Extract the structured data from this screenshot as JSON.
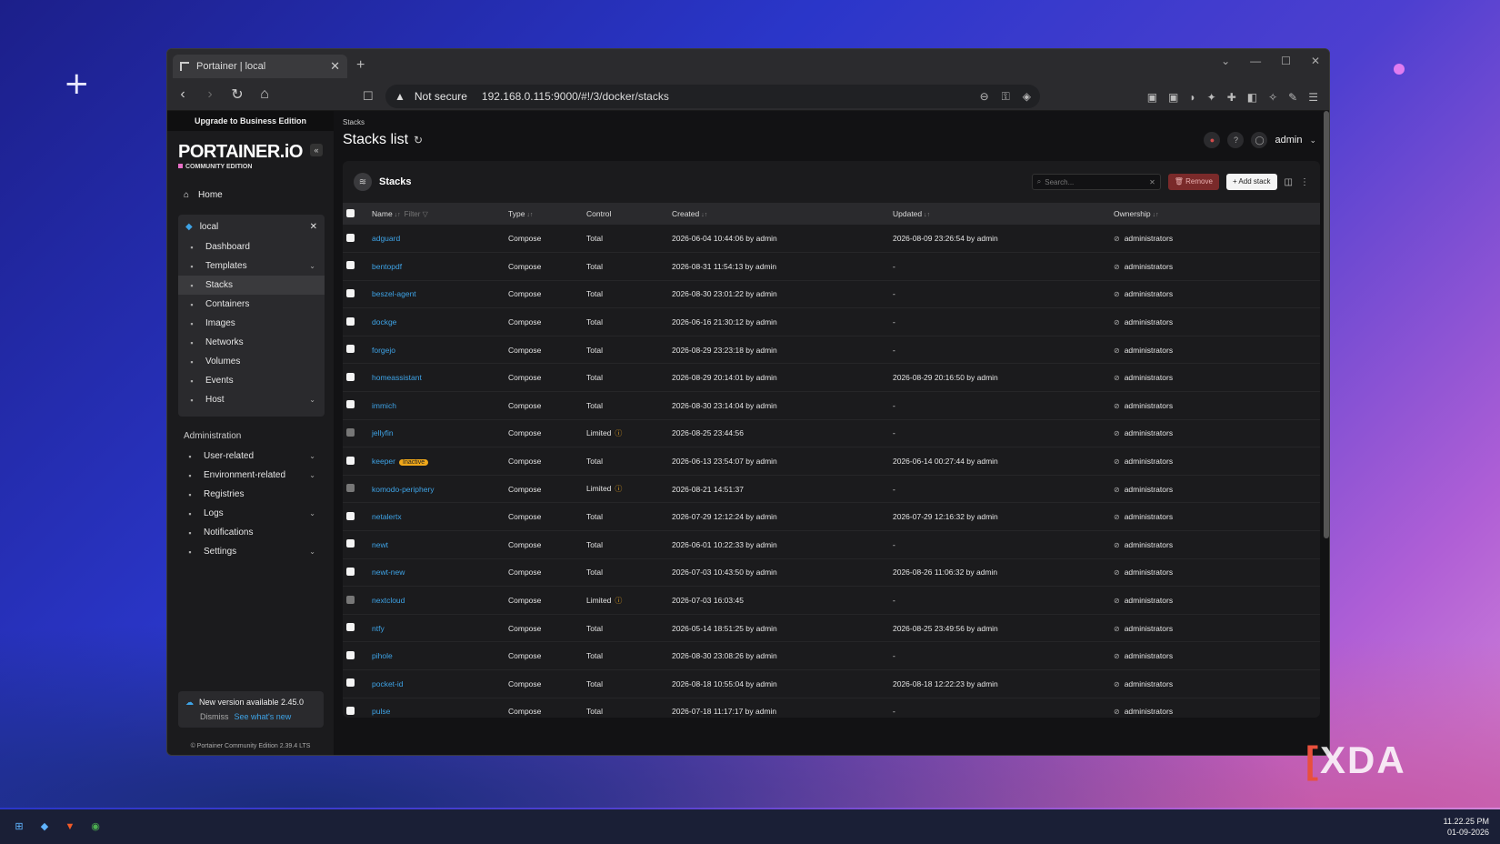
{
  "browser": {
    "tab_title": "Portainer | local",
    "security_label": "Not secure",
    "url": "192.168.0.115:9000/#!/3/docker/stacks"
  },
  "sidebar": {
    "upgrade_label": "Upgrade to Business Edition",
    "logo_main": "PORTAINER.iO",
    "logo_sub": "COMMUNITY EDITION",
    "home_label": "Home",
    "env_name": "local",
    "env_items": [
      {
        "label": "Dashboard",
        "icon": "dashboard-icon"
      },
      {
        "label": "Templates",
        "icon": "templates-icon",
        "chevron": true
      },
      {
        "label": "Stacks",
        "icon": "stacks-icon",
        "active": true
      },
      {
        "label": "Containers",
        "icon": "containers-icon"
      },
      {
        "label": "Images",
        "icon": "images-icon"
      },
      {
        "label": "Networks",
        "icon": "networks-icon"
      },
      {
        "label": "Volumes",
        "icon": "volumes-icon"
      },
      {
        "label": "Events",
        "icon": "events-icon"
      },
      {
        "label": "Host",
        "icon": "host-icon",
        "chevron": true
      }
    ],
    "admin_title": "Administration",
    "admin_items": [
      {
        "label": "User-related",
        "icon": "users-icon",
        "chevron": true
      },
      {
        "label": "Environment-related",
        "icon": "environment-icon",
        "chevron": true
      },
      {
        "label": "Registries",
        "icon": "registries-icon"
      },
      {
        "label": "Logs",
        "icon": "logs-icon",
        "chevron": true
      },
      {
        "label": "Notifications",
        "icon": "bell-icon"
      },
      {
        "label": "Settings",
        "icon": "gear-icon",
        "chevron": true
      }
    ],
    "new_version": "New version available 2.45.0",
    "dismiss": "Dismiss",
    "whats_new": "See what's new",
    "footer": "© Portainer Community Edition 2.39.4 LTS"
  },
  "main": {
    "breadcrumb": "Stacks",
    "page_title": "Stacks list",
    "user": "admin",
    "panel_title": "Stacks",
    "search_placeholder": "Search...",
    "remove_label": "Remove",
    "add_label": "+ Add stack",
    "columns": {
      "name": "Name",
      "filter": "Filter",
      "type": "Type",
      "control": "Control",
      "created": "Created",
      "updated": "Updated",
      "ownership": "Ownership"
    },
    "rows": [
      {
        "name": "adguard",
        "type": "Compose",
        "control": "Total",
        "created": "2026-06-04 10:44:06 by admin",
        "updated": "2026-08-09 23:26:54 by admin",
        "ownership": "administrators"
      },
      {
        "name": "bentopdf",
        "type": "Compose",
        "control": "Total",
        "created": "2026-08-31 11:54:13 by admin",
        "updated": "-",
        "ownership": "administrators"
      },
      {
        "name": "beszel-agent",
        "type": "Compose",
        "control": "Total",
        "created": "2026-08-30 23:01:22 by admin",
        "updated": "-",
        "ownership": "administrators"
      },
      {
        "name": "dockge",
        "type": "Compose",
        "control": "Total",
        "created": "2026-06-16 21:30:12 by admin",
        "updated": "-",
        "ownership": "administrators"
      },
      {
        "name": "forgejo",
        "type": "Compose",
        "control": "Total",
        "created": "2026-08-29 23:23:18 by admin",
        "updated": "-",
        "ownership": "administrators"
      },
      {
        "name": "homeassistant",
        "type": "Compose",
        "control": "Total",
        "created": "2026-08-29 20:14:01 by admin",
        "updated": "2026-08-29 20:16:50 by admin",
        "ownership": "administrators"
      },
      {
        "name": "immich",
        "type": "Compose",
        "control": "Total",
        "created": "2026-08-30 23:14:04 by admin",
        "updated": "-",
        "ownership": "administrators"
      },
      {
        "name": "jellyfin",
        "type": "Compose",
        "control": "Limited",
        "created": "2026-08-25 23:44:56",
        "updated": "-",
        "ownership": "administrators",
        "disabled": true
      },
      {
        "name": "keeper",
        "badge": "Inactive",
        "type": "Compose",
        "control": "Total",
        "created": "2026-06-13 23:54:07 by admin",
        "updated": "2026-06-14 00:27:44 by admin",
        "ownership": "administrators"
      },
      {
        "name": "komodo-periphery",
        "type": "Compose",
        "control": "Limited",
        "created": "2026-08-21 14:51:37",
        "updated": "-",
        "ownership": "administrators",
        "disabled": true
      },
      {
        "name": "netalertx",
        "type": "Compose",
        "control": "Total",
        "created": "2026-07-29 12:12:24 by admin",
        "updated": "2026-07-29 12:16:32 by admin",
        "ownership": "administrators"
      },
      {
        "name": "newt",
        "type": "Compose",
        "control": "Total",
        "created": "2026-06-01 10:22:33 by admin",
        "updated": "-",
        "ownership": "administrators"
      },
      {
        "name": "newt-new",
        "type": "Compose",
        "control": "Total",
        "created": "2026-07-03 10:43:50 by admin",
        "updated": "2026-08-26 11:06:32 by admin",
        "ownership": "administrators"
      },
      {
        "name": "nextcloud",
        "type": "Compose",
        "control": "Limited",
        "created": "2026-07-03 16:03:45",
        "updated": "-",
        "ownership": "administrators",
        "disabled": true
      },
      {
        "name": "ntfy",
        "type": "Compose",
        "control": "Total",
        "created": "2026-05-14 18:51:25 by admin",
        "updated": "2026-08-25 23:49:56 by admin",
        "ownership": "administrators"
      },
      {
        "name": "pihole",
        "type": "Compose",
        "control": "Total",
        "created": "2026-08-30 23:08:26 by admin",
        "updated": "-",
        "ownership": "administrators"
      },
      {
        "name": "pocket-id",
        "type": "Compose",
        "control": "Total",
        "created": "2026-08-18 10:55:04 by admin",
        "updated": "2026-08-18 12:22:23 by admin",
        "ownership": "administrators"
      },
      {
        "name": "pulse",
        "type": "Compose",
        "control": "Total",
        "created": "2026-07-18 11:17:17 by admin",
        "updated": "-",
        "ownership": "administrators"
      }
    ]
  },
  "watermark": "XDA",
  "taskbar": {
    "time": "11.22.25 PM",
    "date": "01-09-2026"
  }
}
